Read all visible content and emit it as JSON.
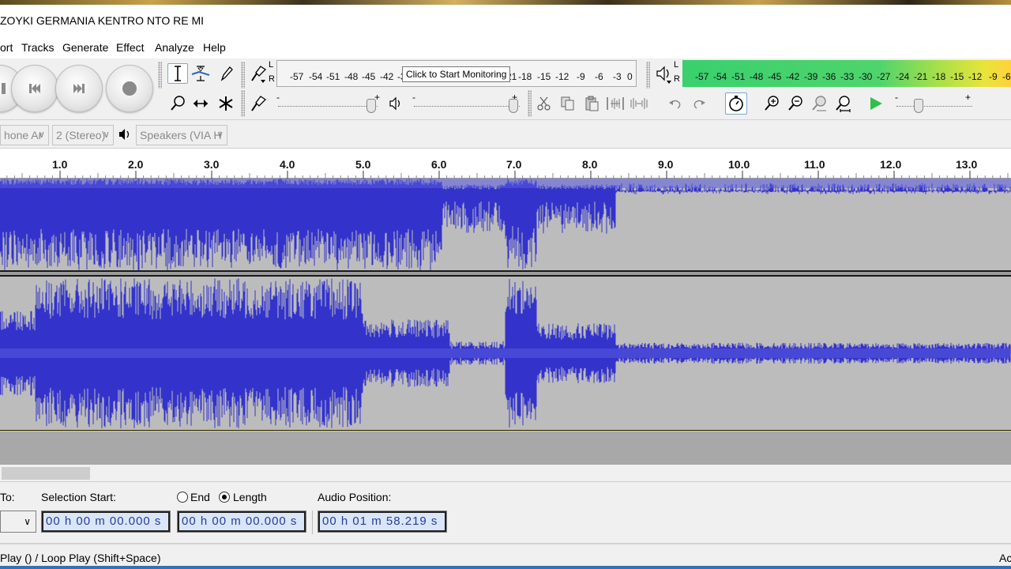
{
  "window": {
    "title": "ZOYKI GERMANIA KENTRO NTO RE MI"
  },
  "menu": [
    "ort",
    "Tracks",
    "Generate",
    "Effect",
    "Analyze",
    "Help"
  ],
  "transport": {
    "buttons": [
      "pause",
      "skip-to-start",
      "skip-to-end",
      "record"
    ]
  },
  "meters": {
    "record_channel_top": "L",
    "record_channel_bottom": "R",
    "record_scale": [
      "-57",
      "-54",
      "-51",
      "-48",
      "-45",
      "-42",
      "-3"
    ],
    "record_scale_right": [
      "21",
      "-18",
      "-15",
      "-12",
      "-9",
      "-6",
      "-3",
      "0"
    ],
    "tooltip": "Click to Start Monitoring",
    "play_channel_top": "L",
    "play_channel_bottom": "R",
    "play_scale": [
      "-57",
      "-54",
      "-51",
      "-48",
      "-45",
      "-42",
      "-39",
      "-36",
      "-33",
      "-30",
      "-27",
      "-24",
      "-21",
      "-18",
      "-15",
      "-12",
      "-9",
      "-6"
    ]
  },
  "mixer": {
    "minus": "-",
    "plus": "+"
  },
  "devices": {
    "input_device": "hone Ar",
    "channels": "2 (Stereo)",
    "output_device": "Speakers (VIA H"
  },
  "ruler": {
    "labels": [
      "1.0",
      "2.0",
      "3.0",
      "4.0",
      "5.0",
      "6.0",
      "7.0",
      "8.0",
      "9.0",
      "10.0",
      "11.0",
      "12.0",
      "13.0"
    ]
  },
  "waveform": {
    "color": "#3333cc"
  },
  "selection": {
    "snap_label": "To:",
    "start_label": "Selection Start:",
    "end_label": "End",
    "length_label": "Length",
    "length_selected": true,
    "audio_position_label": "Audio Position:",
    "selection_start": "00 h 00 m 00.000 s",
    "selection_length": "00 h 00 m 00.000 s",
    "audio_position": "00 h 01 m 58.219 s"
  },
  "status": {
    "text": "Play () / Loop Play (Shift+Space)",
    "right": "Ac"
  }
}
